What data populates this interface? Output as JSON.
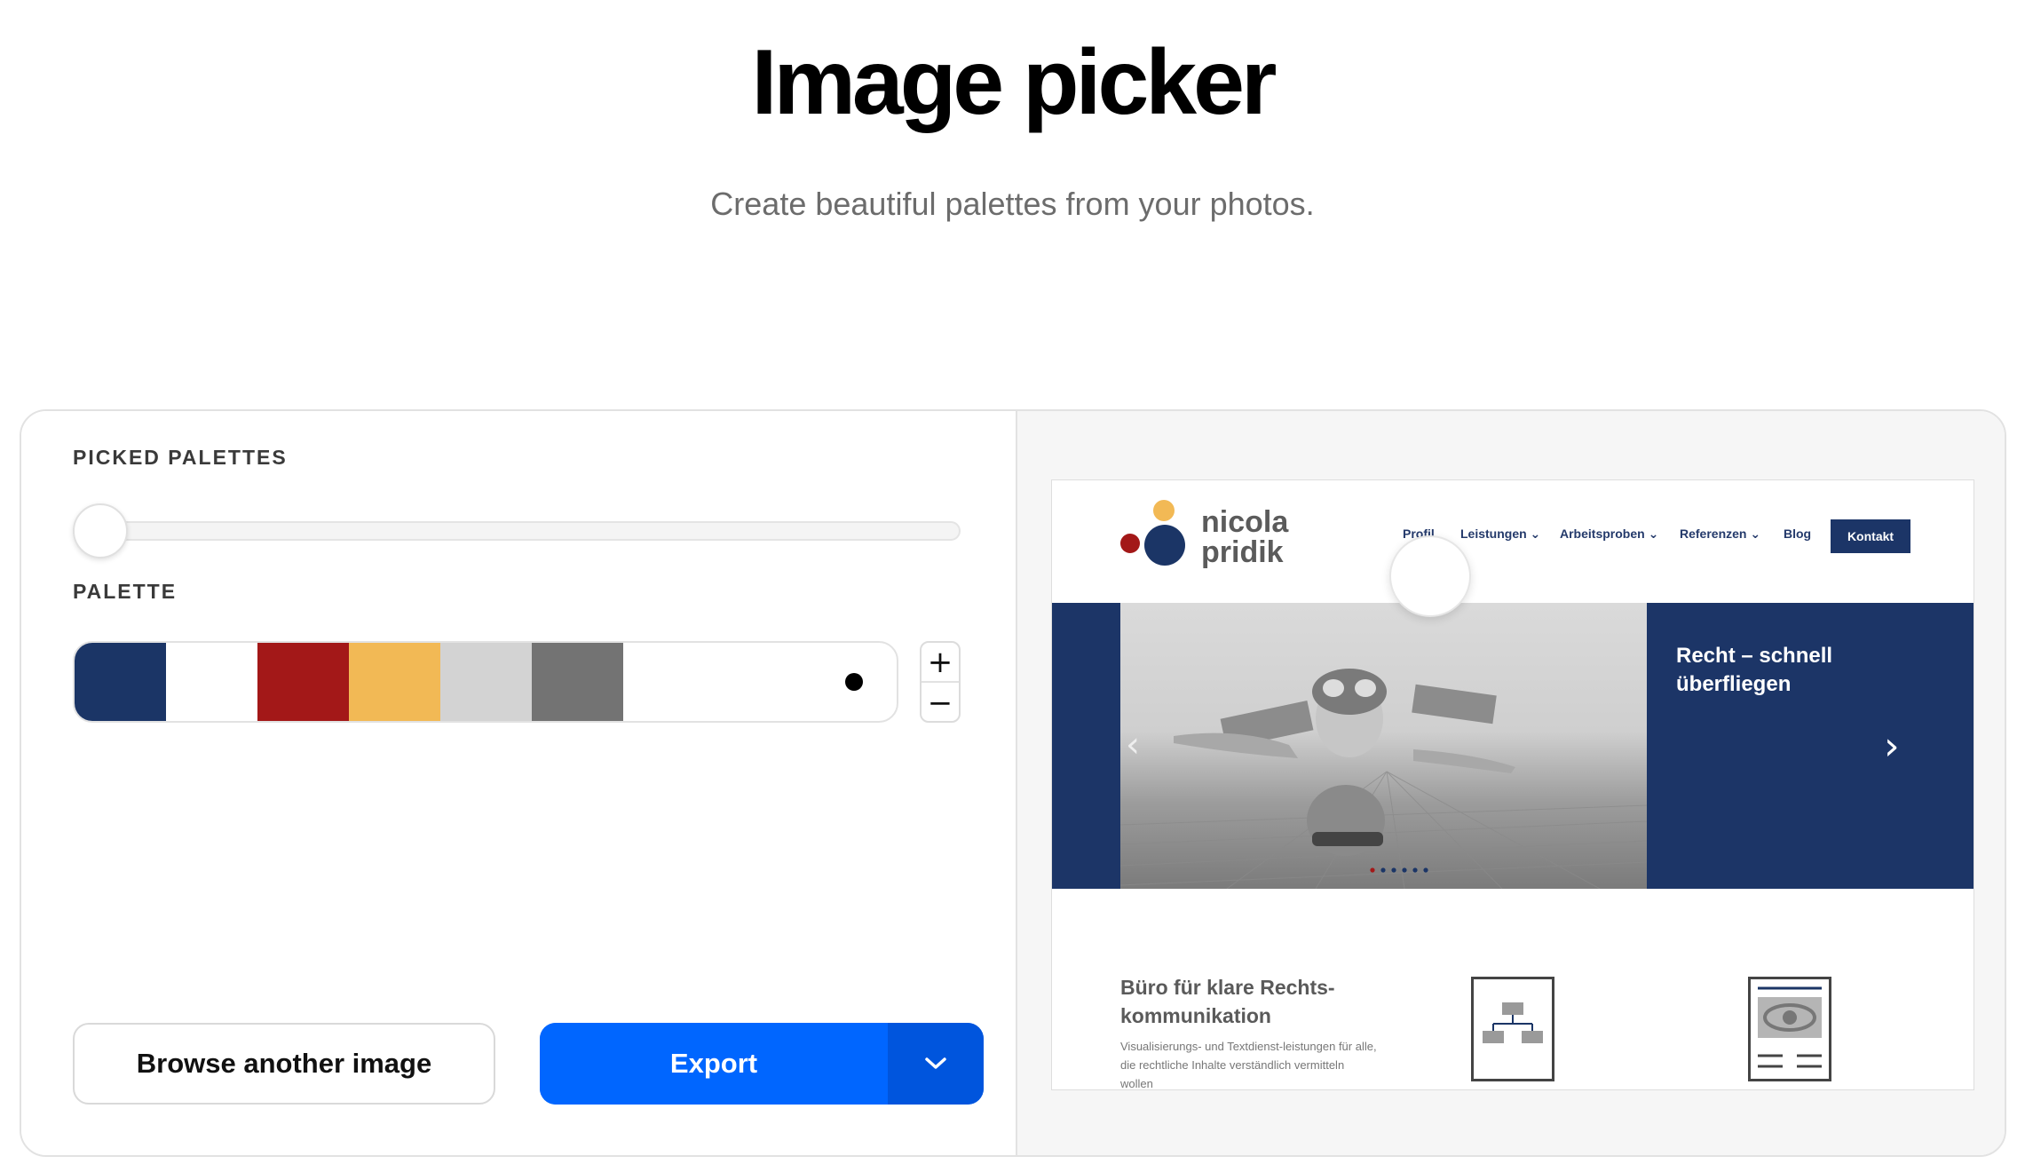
{
  "header": {
    "title": "Image picker",
    "subtitle": "Create beautiful palettes from your photos."
  },
  "editor": {
    "picked_palettes_label": "PICKED PALETTES",
    "palette_label": "PALETTE",
    "picked_palettes_value": 0,
    "palette": [
      {
        "name": "navy",
        "color": "#1b3566"
      },
      {
        "name": "white",
        "color": "#ffffff"
      },
      {
        "name": "red",
        "color": "#a31818"
      },
      {
        "name": "yellow",
        "color": "#f2b955"
      },
      {
        "name": "light-gray",
        "color": "#d3d3d3"
      },
      {
        "name": "gray",
        "color": "#737373"
      }
    ],
    "stepper": {
      "plus": "+",
      "minus": "−"
    },
    "browse_button": "Browse another image",
    "export_button": "Export"
  },
  "preview": {
    "logo_line1": "nicola",
    "logo_line2": "pridik",
    "nav": {
      "profil": "Profil",
      "leistungen": "Leistungen ⌄",
      "arbeitsproben": "Arbeitsproben ⌄",
      "referenzen": "Referenzen ⌄",
      "blog": "Blog",
      "kontakt": "Kontakt"
    },
    "hero_heading": "Recht – schnell überfliegen",
    "content_heading": "Büro für klare Rechts-kommunikation",
    "content_text": "Visualisierungs- und Textdienst-leistungen für alle, die rechtliche Inhalte verständlich vermitteln wollen"
  },
  "colors": {
    "accent": "#0066ff",
    "navy": "#1b3566"
  }
}
